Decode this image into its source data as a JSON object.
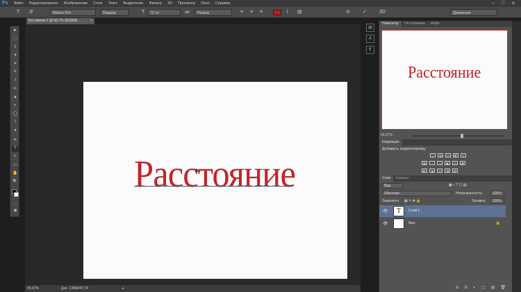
{
  "app": {
    "logo": "Ps"
  },
  "menu": [
    "Файл",
    "Редактирование",
    "Изображение",
    "Слои",
    "Текст",
    "Выделение",
    "Фильтр",
    "3D",
    "Просмотр",
    "Окно",
    "Справка"
  ],
  "window_controls": [
    "–",
    "□",
    "✕"
  ],
  "options_bar": {
    "font_family": "Minion Pro",
    "font_style": "Regular",
    "font_size": "72 пт",
    "antialias_icon": "aA",
    "antialias": "Резкое",
    "text_color": "#c41920",
    "workspace": "Движение"
  },
  "tools": [
    "►",
    "⬚",
    "ℓ",
    "✦",
    "⌗",
    "✎",
    "⚕",
    "✏",
    "▲",
    "◐",
    "◯",
    "⌇",
    "●",
    "✒",
    "T",
    "↖",
    "▭",
    "✋",
    "🔍",
    "…"
  ],
  "document": {
    "tab_title": "Без имени-1 @ 66,7% (RGB/8)",
    "canvas_text": "Расстояние",
    "status_zoom": "66,67%",
    "status_info": "Док: 2,86М/47,7К"
  },
  "navigator": {
    "tabs": [
      "Навигатор",
      "Гистограмма",
      "Инфо"
    ],
    "preview_text": "Расстояние",
    "zoom": "66,67%",
    "slider_level": 0.55
  },
  "adjustments": {
    "tabs": [
      "Коррекция"
    ],
    "subtitle": "Добавить корректировку",
    "row1": [
      "☼",
      "▥",
      "◫",
      "◩",
      "▽",
      ""
    ],
    "row2": [
      "▦",
      "◔",
      "◑",
      "▣",
      "◎",
      "▩"
    ],
    "row3": [
      "◧",
      "◪",
      "◰",
      "◨",
      "▨"
    ]
  },
  "layers": {
    "tabs": [
      "Слои",
      "Каналы"
    ],
    "filter": "Вид",
    "blend_mode": "Обычные",
    "opacity_label": "Непрозрачность:",
    "opacity": "100%",
    "lock_label": "Закрепить:",
    "fill_label": "Заливка:",
    "fill": "100%",
    "items": [
      {
        "name": "Слой 1",
        "thumb": "T",
        "selected": true
      },
      {
        "name": "Фон",
        "thumb": "",
        "selected": false
      }
    ],
    "footer_icons": [
      "⊝",
      "fx",
      "◐",
      "▢",
      "▤",
      "🗑"
    ]
  }
}
